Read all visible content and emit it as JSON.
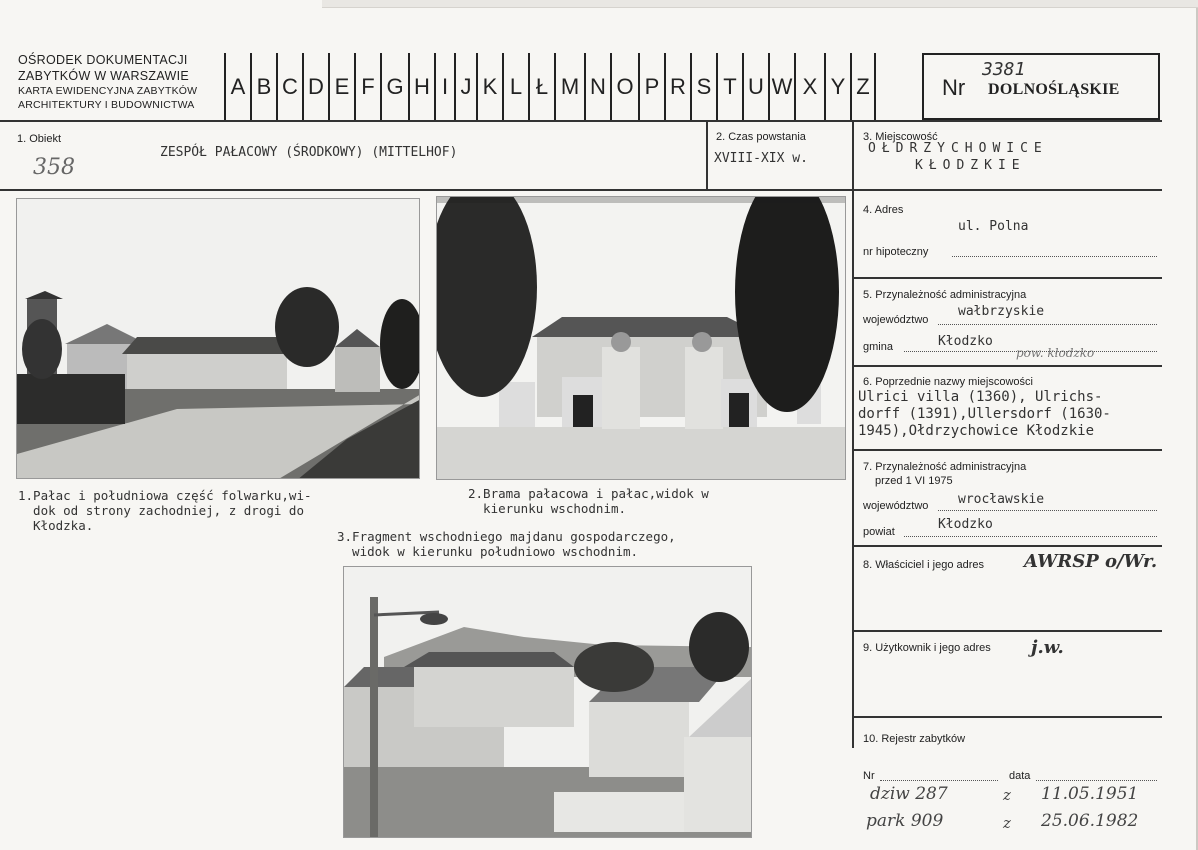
{
  "institution": {
    "line1": "OŚRODEK DOKUMENTACJI",
    "line2": "ZABYTKÓW W WARSZAWIE",
    "line3": "KARTA EWIDENCYJNA ZABYTKÓW",
    "line4": "ARCHITEKTURY I BUDOWNICTWA"
  },
  "alphabet": [
    "A",
    "B",
    "C",
    "D",
    "E",
    "F",
    "G",
    "H",
    "I",
    "J",
    "K",
    "L",
    "Ł",
    "M",
    "N",
    "O",
    "P",
    "R",
    "S",
    "T",
    "U",
    "W",
    "X",
    "Y",
    "Z"
  ],
  "number": {
    "label": "Nr",
    "value": "3381",
    "region": "DOLNOŚLĄSKIE"
  },
  "field1": {
    "label": "1. Obiekt",
    "value": "ZESPÓŁ PAŁACOWY (ŚRODKOWY) (MITTELHOF)",
    "hand_number": "358"
  },
  "field2": {
    "label": "2. Czas powstania",
    "value": "XVIII-XIX w."
  },
  "field3": {
    "label": "3. Miejscowość",
    "line1": "OŁDRZYCHOWICE",
    "line2": "KŁODZKIE"
  },
  "field4": {
    "label": "4. Adres",
    "value": "ul. Polna",
    "sub_label": "nr hipoteczny"
  },
  "field5": {
    "label": "5. Przynależność administracyjna",
    "woj_label": "województwo",
    "woj_value": "wałbrzyskie",
    "gmina_label": "gmina",
    "gmina_value": "Kłodzko",
    "gmina_note": "pow. kłodzko"
  },
  "field6": {
    "label": "6. Poprzednie nazwy miejscowości",
    "line1": "Ulrici villa (1360), Ulrichs-",
    "line2": "dorff (1391),Ullersdorf (1630-",
    "line3": "1945),Ołdrzychowice Kłodzkie"
  },
  "field7": {
    "label_line1": "7. Przynależność administracyjna",
    "label_line2": "przed 1 VI 1975",
    "woj_label": "województwo",
    "woj_value": "wrocławskie",
    "powiat_label": "powiat",
    "powiat_value": "Kłodzko"
  },
  "field8": {
    "label": "8. Właściciel i jego adres",
    "value": "AWRSP o/Wr."
  },
  "field9": {
    "label": "9. Użytkownik i jego adres",
    "value": "j.w."
  },
  "field10": {
    "label": "10. Rejestr zabytków",
    "nr_label": "Nr",
    "data_label": "data",
    "entry1_nr": "dziw 287",
    "entry1_z": "z",
    "entry1_date": "11.05.1951",
    "entry2_nr": "park 909",
    "entry2_z": "z",
    "entry2_date": "25.06.1982"
  },
  "captions": {
    "photo1": "1.Pałac i południowa część folwarku,wi-\n  dok od strony zachodniej, z drogi do\n  Kłodzka.",
    "photo2": "2.Brama pałacowa i pałac,widok w\n  kierunku wschodnim.",
    "photo3": "3.Fragment wschodniego majdanu gospodarczego,\n  widok w kierunku południowo wschodnim."
  },
  "colors": {
    "paper": "#f7f6f3",
    "ink": "#222222",
    "typewriter": "#333333"
  }
}
